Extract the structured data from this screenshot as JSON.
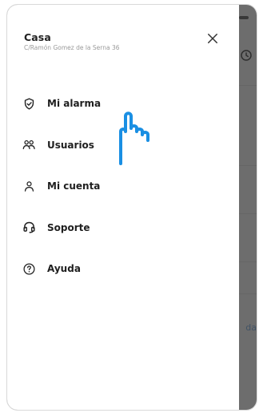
{
  "drawer": {
    "home_name": "Casa",
    "home_address": "C/Ramón Gomez de la Serna 36",
    "close_icon": "close-icon",
    "items": [
      {
        "label": "Mi alarma",
        "icon": "shield-check-icon"
      },
      {
        "label": "Usuarios",
        "icon": "users-icon"
      },
      {
        "label": "Mi cuenta",
        "icon": "user-icon"
      },
      {
        "label": "Soporte",
        "icon": "headset-icon"
      },
      {
        "label": "Ayuda",
        "icon": "help-icon"
      }
    ]
  },
  "background": {
    "link_fragment": "da"
  },
  "colors": {
    "overlay": "#000000",
    "accent_blue": "#1a8fe3",
    "text": "#1f1f1f",
    "muted": "#9a9a9a"
  }
}
